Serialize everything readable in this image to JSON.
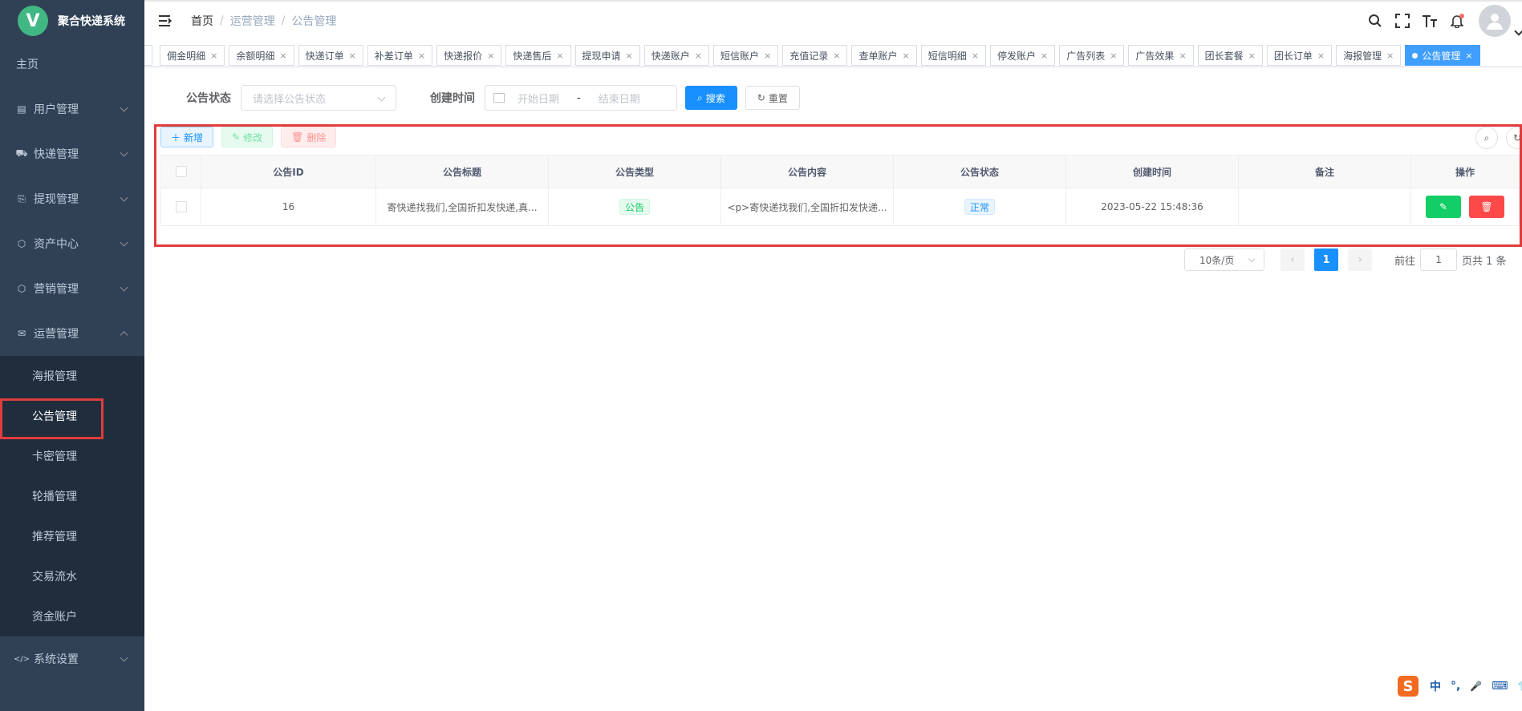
{
  "app": {
    "logo_letter": "V",
    "title": "聚合快递系统"
  },
  "sidebar": {
    "home": "主页",
    "items": [
      {
        "label": "用户管理",
        "icon": "list-icon",
        "glyph": "▤"
      },
      {
        "label": "快递管理",
        "icon": "delivery-icon",
        "glyph": "⛟"
      },
      {
        "label": "提现管理",
        "icon": "withdraw-icon",
        "glyph": "⎘"
      },
      {
        "label": "资产中心",
        "icon": "cube-icon",
        "glyph": "⬡"
      },
      {
        "label": "营销管理",
        "icon": "cube-icon",
        "glyph": "⬡"
      },
      {
        "label": "运营管理",
        "icon": "mail-icon",
        "glyph": "✉"
      }
    ],
    "sub_items": [
      "海报管理",
      "公告管理",
      "卡密管理",
      "轮播管理",
      "推荐管理",
      "交易流水",
      "资金账户"
    ],
    "settings": {
      "label": "系统设置",
      "glyph": "</>"
    }
  },
  "breadcrumb": [
    "首页",
    "运营管理",
    "公告管理"
  ],
  "tags": [
    "佣金明细",
    "余额明细",
    "快递订单",
    "补差订单",
    "快递报价",
    "快递售后",
    "提现申请",
    "快递账户",
    "短信账户",
    "充值记录",
    "查单账户",
    "短信明细",
    "停发账户",
    "广告列表",
    "广告效果",
    "团长套餐",
    "团长订单",
    "海报管理"
  ],
  "active_tag": "公告管理",
  "search": {
    "status_label": "公告状态",
    "status_placeholder": "请选择公告状态",
    "time_label": "创建时间",
    "start_placeholder": "开始日期",
    "range_sep": "-",
    "end_placeholder": "结束日期",
    "search_btn": "搜索",
    "reset_btn": "重置"
  },
  "toolbar": {
    "add": "新增",
    "edit": "修改",
    "delete": "删除"
  },
  "table": {
    "headers": [
      "公告ID",
      "公告标题",
      "公告类型",
      "公告内容",
      "公告状态",
      "创建时间",
      "备注",
      "操作"
    ],
    "rows": [
      {
        "id": "16",
        "title": "寄快递找我们,全国折扣发快递,真...",
        "type": "公告",
        "content": "<p>寄快递找我们,全国折扣发快递...",
        "status": "正常",
        "created": "2023-05-22 15:48:36",
        "remark": ""
      }
    ]
  },
  "pagination": {
    "page_size": "10条/页",
    "current": "1",
    "goto_label": "前往",
    "goto_value": "1",
    "total_text": "页共 1 条"
  },
  "ime": {
    "logo": "S",
    "lang": "中",
    "punct": "°,",
    "mic": "🎤",
    "kbd": "⌨",
    "skin": "👕"
  },
  "colors": {
    "sidebar_bg": "#304156",
    "primary": "#1890ff",
    "highlight_box": "#e03c3c"
  }
}
